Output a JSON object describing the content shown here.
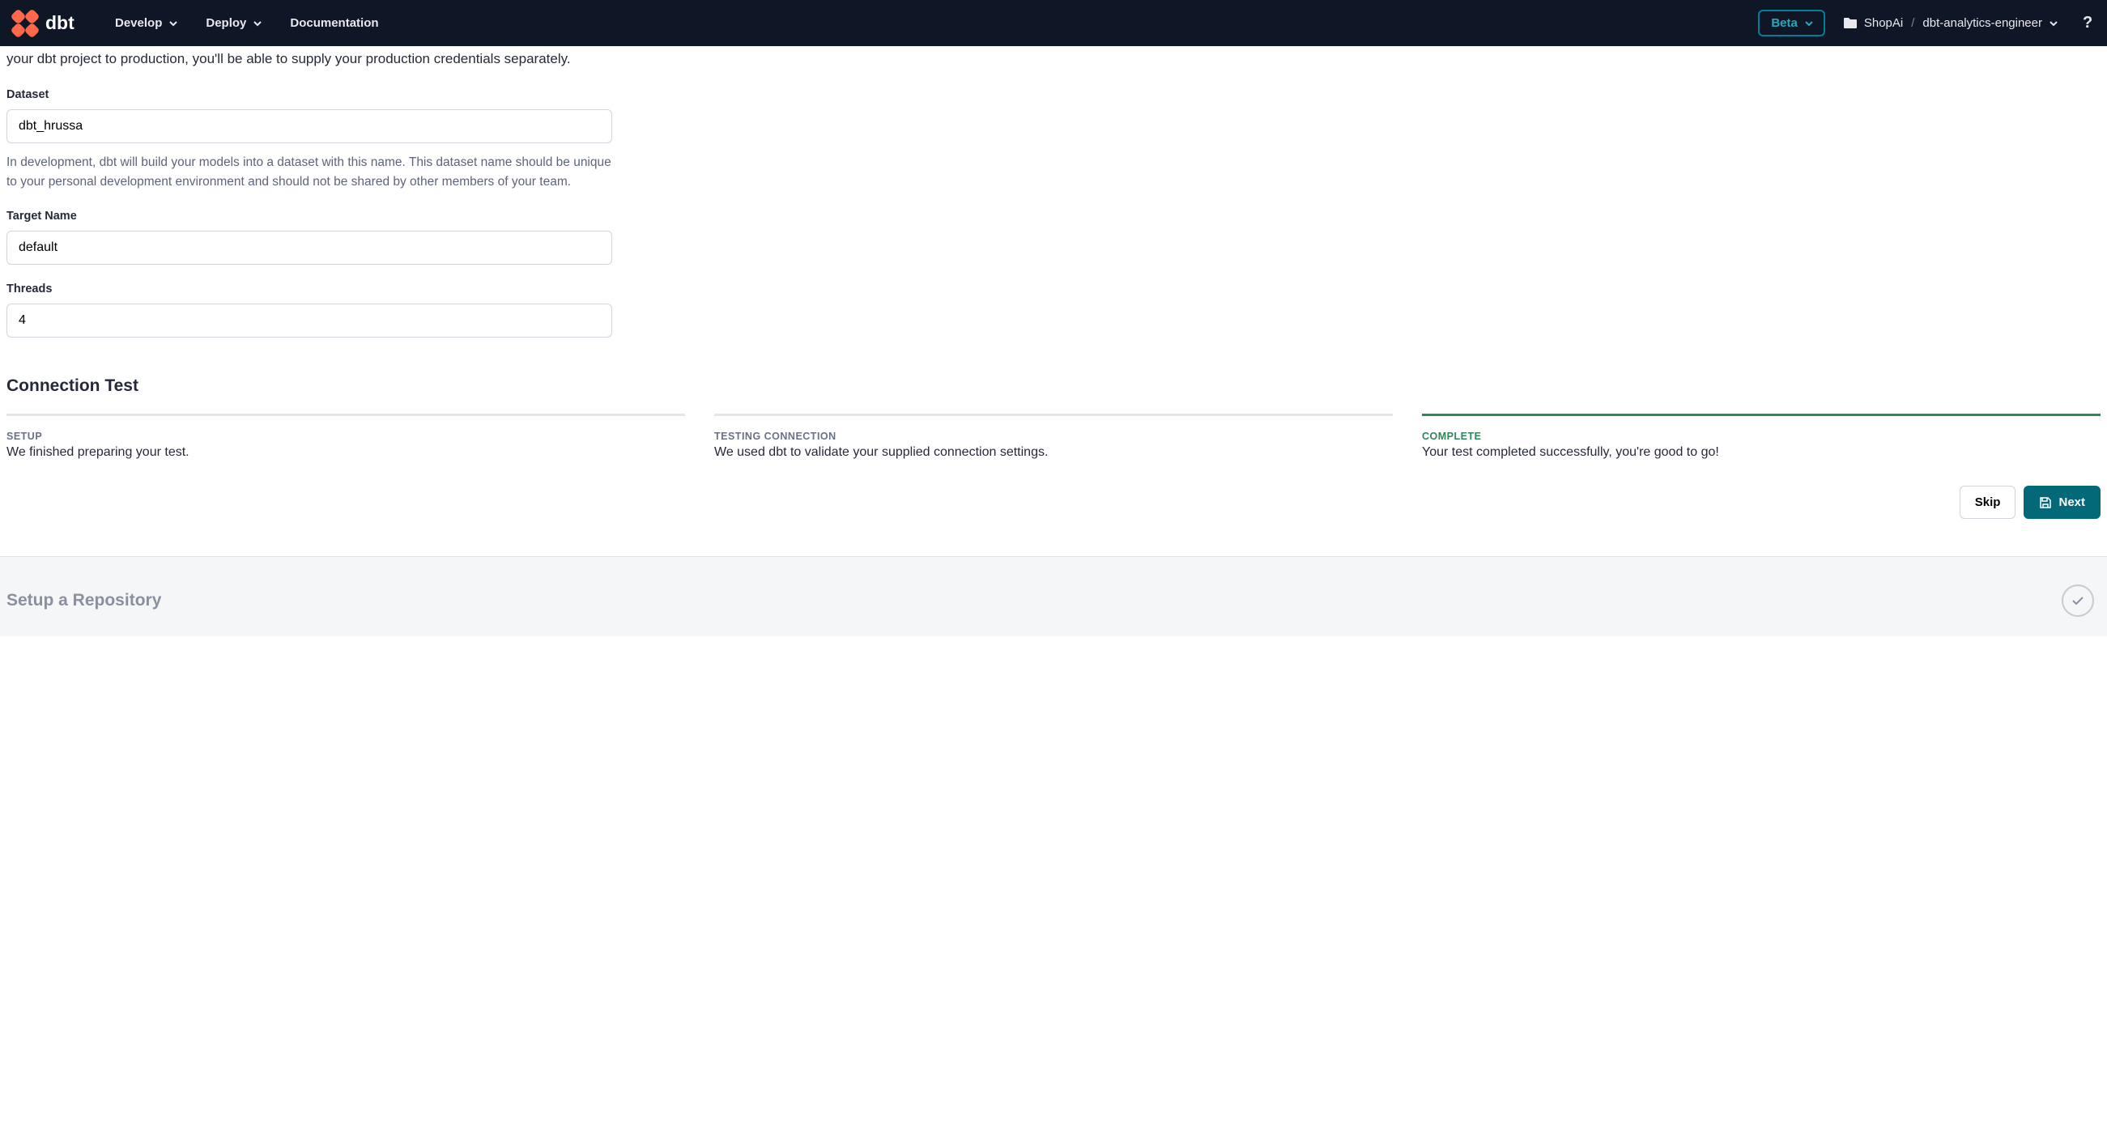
{
  "nav": {
    "develop": "Develop",
    "deploy": "Deploy",
    "documentation": "Documentation",
    "beta": "Beta",
    "org": "ShopAi",
    "project": "dbt-analytics-engineer"
  },
  "intro_line": "your dbt project to production, you'll be able to supply your production credentials separately.",
  "fields": {
    "dataset": {
      "label": "Dataset",
      "value": "dbt_hrussa",
      "help": "In development, dbt will build your models into a dataset with this name. This dataset name should be unique to your personal development environment and should not be shared by other members of your team."
    },
    "target": {
      "label": "Target Name",
      "value": "default"
    },
    "threads": {
      "label": "Threads",
      "value": "4"
    }
  },
  "test": {
    "heading": "Connection Test",
    "cols": [
      {
        "label": "SETUP",
        "desc": "We finished preparing your test.",
        "done": false
      },
      {
        "label": "TESTING CONNECTION",
        "desc": "We used dbt to validate your supplied connection settings.",
        "done": false
      },
      {
        "label": "COMPLETE",
        "desc": "Your test completed successfully, you're good to go!",
        "done": true
      }
    ]
  },
  "actions": {
    "skip": "Skip",
    "next": "Next"
  },
  "repo": {
    "heading": "Setup a Repository"
  }
}
